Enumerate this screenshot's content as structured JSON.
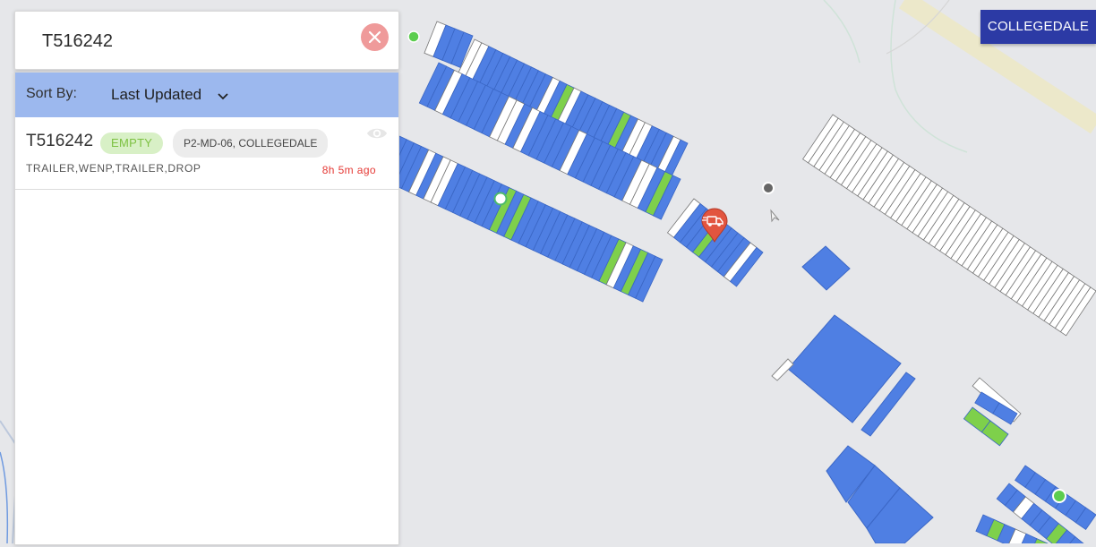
{
  "search": {
    "value": "T516242"
  },
  "sort": {
    "label": "Sort By:",
    "value": "Last Updated"
  },
  "result": {
    "trailer_id": "T516242",
    "status": "EMPTY",
    "location": "P2-MD-06, COLLEGEDALE",
    "tags": "TRAILER,WENP,TRAILER,DROP",
    "time_ago": "8h 5m ago"
  },
  "yard_button": {
    "label": "COLLEGEDALE"
  },
  "colors": {
    "occupied": "#4f7fe3",
    "empty_slot": "#ffffff",
    "selected": "#7ed04b",
    "status_empty_text": "#7dc142",
    "time_red": "#e53935",
    "yard_button": "#2c3aa5",
    "sort_bar": "#9cb8ee",
    "truck_marker": "#e2553f"
  },
  "icons": [
    "close-icon",
    "chevron-down-icon",
    "eye-icon",
    "truck-marker-icon",
    "cursor-icon"
  ]
}
